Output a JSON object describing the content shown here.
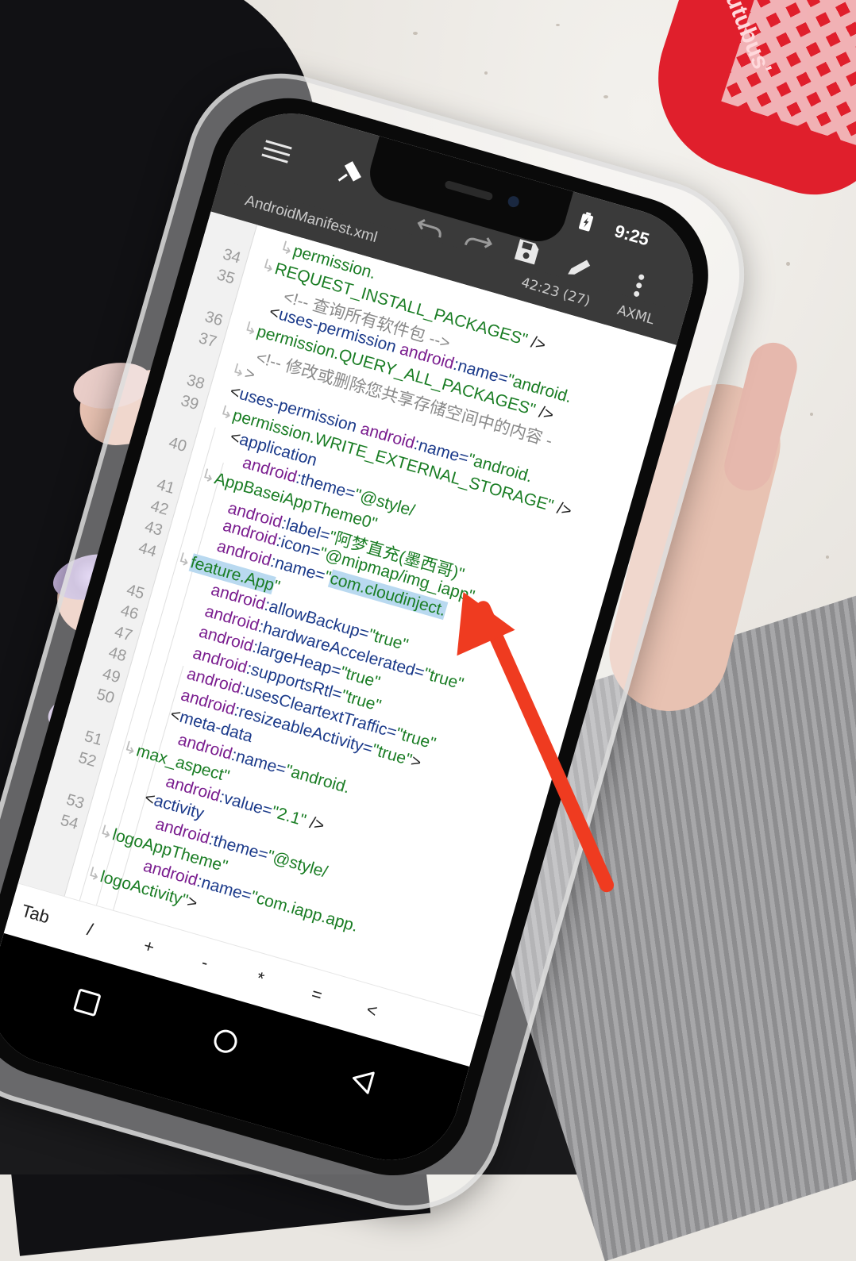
{
  "status_bar": {
    "time": "9:25",
    "battery_icon": "battery-charging-icon"
  },
  "toolbar": {
    "menu_icon": "hamburger-menu-icon",
    "pin_icon": "pin-icon",
    "undo_icon": "undo-icon",
    "redo_icon": "redo-icon",
    "save_icon": "save-icon",
    "edit_icon": "pencil-icon",
    "more_icon": "more-vertical-icon"
  },
  "file_tab": {
    "filename": "AndroidManifest.xml",
    "cursor_position": "42:23 (27)",
    "mode": "AXML"
  },
  "editor": {
    "line_numbers": [
      "34",
      "35",
      "36",
      "37",
      "38",
      "39",
      "40",
      "41",
      "42",
      "43",
      "44",
      "45",
      "46",
      "47",
      "48",
      "49",
      "50",
      "51",
      "52",
      "53",
      "54"
    ],
    "lines": [
      {
        "segments": [
          {
            "t": "permission.",
            "c": "vl"
          }
        ],
        "wrap": true
      },
      {
        "segments": [
          {
            "t": "REQUEST_INSTALL_PACKAGES\"",
            "c": "vl"
          },
          {
            "t": " />",
            "c": "pu"
          }
        ],
        "wrap": true
      },
      {
        "segments": [
          {
            "t": "<!-- 查询所有软件包 -->",
            "c": "cm"
          }
        ]
      },
      {
        "segments": [
          {
            "t": "<",
            "c": "pu"
          },
          {
            "t": "uses-permission",
            "c": "tg"
          },
          {
            "t": " android",
            "c": "at"
          },
          {
            "t": ":name=",
            "c": "tg"
          },
          {
            "t": "\"android.",
            "c": "vl"
          }
        ]
      },
      {
        "segments": [
          {
            "t": "permission.QUERY_ALL_PACKAGES\"",
            "c": "vl"
          },
          {
            "t": " />",
            "c": "pu"
          }
        ],
        "wrap": true
      },
      {
        "segments": [
          {
            "t": "<!-- 修改或删除您共享存储空间中的内容 -",
            "c": "cm"
          }
        ]
      },
      {
        "segments": [
          {
            "t": ">",
            "c": "cm"
          }
        ],
        "wrap": true
      },
      {
        "segments": [
          {
            "t": "<",
            "c": "pu"
          },
          {
            "t": "uses-permission",
            "c": "tg"
          },
          {
            "t": " android",
            "c": "at"
          },
          {
            "t": ":name=",
            "c": "tg"
          },
          {
            "t": "\"android.",
            "c": "vl"
          }
        ]
      },
      {
        "segments": [
          {
            "t": "permission.WRITE_EXTERNAL_STORAGE\"",
            "c": "vl"
          },
          {
            "t": " />",
            "c": "pu"
          }
        ],
        "wrap": true
      },
      {
        "segments": [
          {
            "t": "<",
            "c": "pu"
          },
          {
            "t": "application",
            "c": "tg"
          }
        ]
      },
      {
        "segments": [
          {
            "t": "android",
            "c": "at"
          },
          {
            "t": ":theme=",
            "c": "tg"
          },
          {
            "t": "\"@style/",
            "c": "vl"
          }
        ]
      },
      {
        "segments": [
          {
            "t": "AppBaseiAppTheme0\"",
            "c": "vl"
          }
        ],
        "wrap": true
      },
      {
        "segments": [
          {
            "t": "android",
            "c": "at"
          },
          {
            "t": ":label=",
            "c": "tg"
          },
          {
            "t": "\"阿梦直充(墨西哥)\"",
            "c": "vl"
          }
        ]
      },
      {
        "segments": [
          {
            "t": "android",
            "c": "at"
          },
          {
            "t": ":icon=",
            "c": "tg"
          },
          {
            "t": "\"@mipmap/img_iapp\"",
            "c": "vl"
          }
        ]
      },
      {
        "segments": [
          {
            "t": "android",
            "c": "at"
          },
          {
            "t": ":name=",
            "c": "tg"
          },
          {
            "t": "\"",
            "c": "vl"
          },
          {
            "t": "com.cloudinject.",
            "c": "vl",
            "hl": true
          }
        ]
      },
      {
        "segments": [
          {
            "t": "feature.App",
            "c": "vl",
            "hl": true
          },
          {
            "t": "\"",
            "c": "vl"
          }
        ],
        "wrap": true
      },
      {
        "segments": [
          {
            "t": "android",
            "c": "at"
          },
          {
            "t": ":allowBackup=",
            "c": "tg"
          },
          {
            "t": "\"true\"",
            "c": "vl"
          }
        ]
      },
      {
        "segments": [
          {
            "t": "android",
            "c": "at"
          },
          {
            "t": ":hardwareAccelerated=",
            "c": "tg"
          },
          {
            "t": "\"true\"",
            "c": "vl"
          }
        ]
      },
      {
        "segments": [
          {
            "t": "android",
            "c": "at"
          },
          {
            "t": ":largeHeap=",
            "c": "tg"
          },
          {
            "t": "\"true\"",
            "c": "vl"
          }
        ]
      },
      {
        "segments": [
          {
            "t": "android",
            "c": "at"
          },
          {
            "t": ":supportsRtl=",
            "c": "tg"
          },
          {
            "t": "\"true\"",
            "c": "vl"
          }
        ]
      },
      {
        "segments": [
          {
            "t": "android",
            "c": "at"
          },
          {
            "t": ":usesCleartextTraffic=",
            "c": "tg"
          },
          {
            "t": "\"true\"",
            "c": "vl"
          }
        ]
      },
      {
        "segments": [
          {
            "t": "android",
            "c": "at"
          },
          {
            "t": ":resizeableActivity=",
            "c": "tg"
          },
          {
            "t": "\"true\"",
            "c": "vl"
          },
          {
            "t": ">",
            "c": "pu"
          }
        ]
      },
      {
        "segments": [
          {
            "t": "<",
            "c": "pu"
          },
          {
            "t": "meta-data",
            "c": "tg"
          }
        ]
      },
      {
        "segments": [
          {
            "t": "android",
            "c": "at"
          },
          {
            "t": ":name=",
            "c": "tg"
          },
          {
            "t": "\"android.",
            "c": "vl"
          }
        ]
      },
      {
        "segments": [
          {
            "t": "max_aspect\"",
            "c": "vl"
          }
        ],
        "wrap": true
      },
      {
        "segments": [
          {
            "t": "android",
            "c": "at"
          },
          {
            "t": ":value=",
            "c": "tg"
          },
          {
            "t": "\"2.1\"",
            "c": "vl"
          },
          {
            "t": " />",
            "c": "pu"
          }
        ]
      },
      {
        "segments": [
          {
            "t": "<",
            "c": "pu"
          },
          {
            "t": "activity",
            "c": "tg"
          }
        ]
      },
      {
        "segments": [
          {
            "t": "android",
            "c": "at"
          },
          {
            "t": ":theme=",
            "c": "tg"
          },
          {
            "t": "\"@style/",
            "c": "vl"
          }
        ]
      },
      {
        "segments": [
          {
            "t": "logoAppTheme\"",
            "c": "vl"
          }
        ],
        "wrap": true
      },
      {
        "segments": [
          {
            "t": "android",
            "c": "at"
          },
          {
            "t": ":name=",
            "c": "tg"
          },
          {
            "t": "\"com.iapp.app.",
            "c": "vl"
          }
        ]
      },
      {
        "segments": [
          {
            "t": "logoActivity\"",
            "c": "vl"
          },
          {
            "t": ">",
            "c": "pu"
          }
        ],
        "wrap": true
      }
    ]
  },
  "symbol_keys": [
    "Tab",
    "/",
    "+",
    "-",
    "*",
    "=",
    "<"
  ],
  "nav_bar": {
    "recents_icon": "square-recents-icon",
    "home_icon": "circle-home-icon",
    "back_icon": "triangle-back-icon"
  },
  "background_brand_text": "tutubus'",
  "colors": {
    "tag": "#1b3a8a",
    "attr": "#7a1d8f",
    "value": "#1a7d24",
    "comment": "#8a8a8a",
    "selection": "#b9d9f0",
    "toolbar": "#3a3a3a",
    "arrow": "#ef3b20"
  }
}
